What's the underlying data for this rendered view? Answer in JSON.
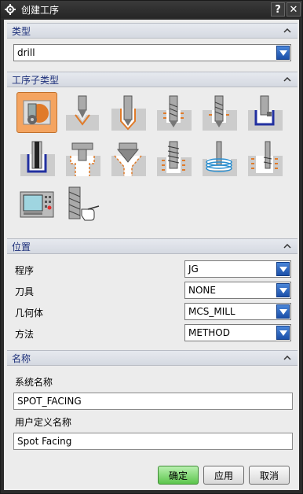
{
  "window": {
    "title": "创建工序",
    "help_label": "?",
    "close_label": "✕"
  },
  "type_section": {
    "header": "类型",
    "value": "drill"
  },
  "subtype_section": {
    "header": "工序子类型",
    "tiles": [
      {
        "name": "spot-facing-icon",
        "selected": true
      },
      {
        "name": "spot-drilling-icon"
      },
      {
        "name": "drilling-icon"
      },
      {
        "name": "peck-drilling-icon"
      },
      {
        "name": "breakchip-drilling-icon"
      },
      {
        "name": "boring-icon"
      },
      {
        "name": "reaming-icon"
      },
      {
        "name": "counterboring-icon"
      },
      {
        "name": "countersinking-icon"
      },
      {
        "name": "tapping-icon"
      },
      {
        "name": "hole-milling-icon"
      },
      {
        "name": "thread-milling-icon"
      },
      {
        "name": "mill-control-icon"
      },
      {
        "name": "mill-user-icon"
      }
    ]
  },
  "location_section": {
    "header": "位置",
    "rows": [
      {
        "label": "程序",
        "value": "JG"
      },
      {
        "label": "刀具",
        "value": "NONE"
      },
      {
        "label": "几何体",
        "value": "MCS_MILL"
      },
      {
        "label": "方法",
        "value": "METHOD"
      }
    ]
  },
  "name_section": {
    "header": "名称",
    "system_name_label": "系统名称",
    "system_name_value": "SPOT_FACING",
    "user_name_label": "用户定义名称",
    "user_name_value": "Spot Facing"
  },
  "buttons": {
    "ok": "确定",
    "apply": "应用",
    "cancel": "取消"
  },
  "colors": {
    "header_text": "#1c2f7a",
    "accent_orange": "#e07b2a",
    "selected_tile": "#f4a460"
  }
}
